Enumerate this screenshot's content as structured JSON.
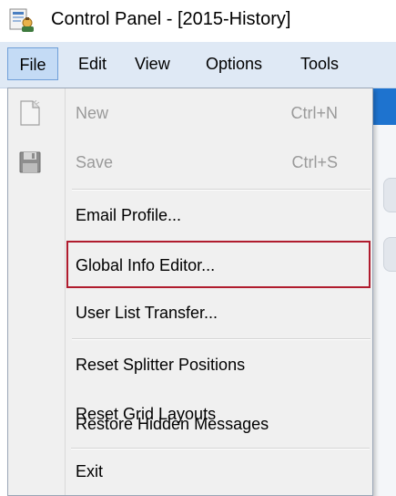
{
  "window": {
    "title": "Control Panel - [2015-History]",
    "icon": "control-panel-icon"
  },
  "menubar": {
    "items": [
      {
        "label": "File"
      },
      {
        "label": "Edit"
      },
      {
        "label": "View"
      },
      {
        "label": "Options"
      },
      {
        "label": "Tools"
      }
    ]
  },
  "file_menu": {
    "new": {
      "label": "New",
      "shortcut": "Ctrl+N",
      "enabled": false,
      "icon": "new-document-icon"
    },
    "save": {
      "label": "Save",
      "shortcut": "Ctrl+S",
      "enabled": false,
      "icon": "floppy-disk-icon"
    },
    "email_profile": {
      "label": "Email Profile..."
    },
    "global_info_editor": {
      "label": "Global Info Editor...",
      "highlighted": true
    },
    "user_list_transfer": {
      "label": "User List Transfer..."
    },
    "reset_splitter": {
      "label": "Reset Splitter Positions"
    },
    "reset_grid": {
      "label": "Reset Grid Layouts"
    },
    "restore_hidden": {
      "label": "Restore Hidden Messages"
    },
    "exit": {
      "label": "Exit"
    }
  },
  "colors": {
    "menubar_bg": "#dfe9f5",
    "menu_bg": "#f0f0f0",
    "highlight_border": "#b01c2e",
    "disabled_text": "#9a9a9a",
    "background_accent": "#1e73cf"
  }
}
